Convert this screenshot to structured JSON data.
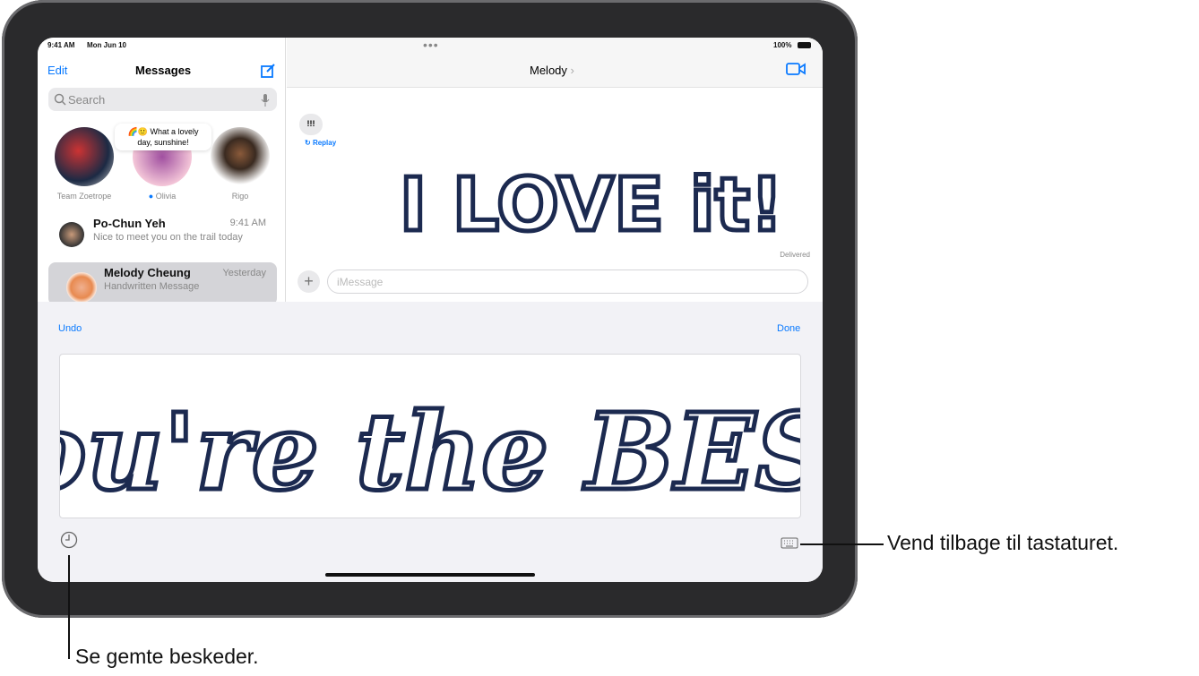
{
  "status_bar": {
    "time": "9:41 AM",
    "date": "Mon Jun 10",
    "battery": "100%"
  },
  "sidebar": {
    "edit": "Edit",
    "title": "Messages",
    "search_placeholder": "Search",
    "pinned": [
      {
        "name": "Team Zoetrope"
      },
      {
        "name": "Olivia",
        "bubble": "🌈🙂 What a lovely day, sunshine!"
      },
      {
        "name": "Rigo"
      }
    ],
    "conversations": [
      {
        "name": "Po-Chun Yeh",
        "time": "9:41 AM",
        "preview": "Nice to meet you on the trail today"
      },
      {
        "name": "Melody Cheung",
        "time": "Yesterday",
        "preview": "Handwritten Message"
      }
    ]
  },
  "chat": {
    "contact": "Melody",
    "bubble": "!!!",
    "replay": "Replay",
    "handwritten_message": "I LOVE it!",
    "delivered": "Delivered",
    "input_placeholder": "iMessage"
  },
  "handwriting": {
    "undo": "Undo",
    "done": "Done",
    "drawing": "You're the BEST"
  },
  "callouts": {
    "keyboard": "Vend tilbage til tastaturet.",
    "saved": "Se gemte beskeder."
  },
  "colors": {
    "accent": "#0a7aff",
    "ink": "#1c2a50"
  }
}
